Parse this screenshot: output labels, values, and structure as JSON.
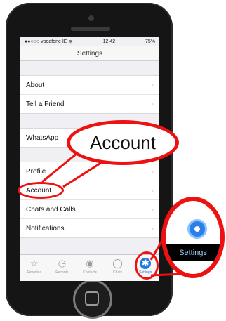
{
  "status": {
    "carrier": "●●○○○ vodafone IE ᯤ",
    "time": "12:42",
    "battery": "75%"
  },
  "nav": {
    "title": "Settings"
  },
  "groups": [
    [
      "About",
      "Tell a Friend"
    ],
    [
      "WhatsApp"
    ],
    [
      "Profile",
      "Account",
      "Chats and Calls",
      "Notifications"
    ]
  ],
  "tabs": [
    {
      "label": "Favorites",
      "icon": "star-icon"
    },
    {
      "label": "Recents",
      "icon": "clock-icon"
    },
    {
      "label": "Contacts",
      "icon": "person-icon"
    },
    {
      "label": "Chats",
      "icon": "chat-bubble-icon"
    },
    {
      "label": "Settings",
      "icon": "gear-icon"
    }
  ],
  "callouts": {
    "account": "Account",
    "settings": "Settings"
  },
  "colors": {
    "accent": "#1e7be4",
    "highlight": "#e11111"
  }
}
